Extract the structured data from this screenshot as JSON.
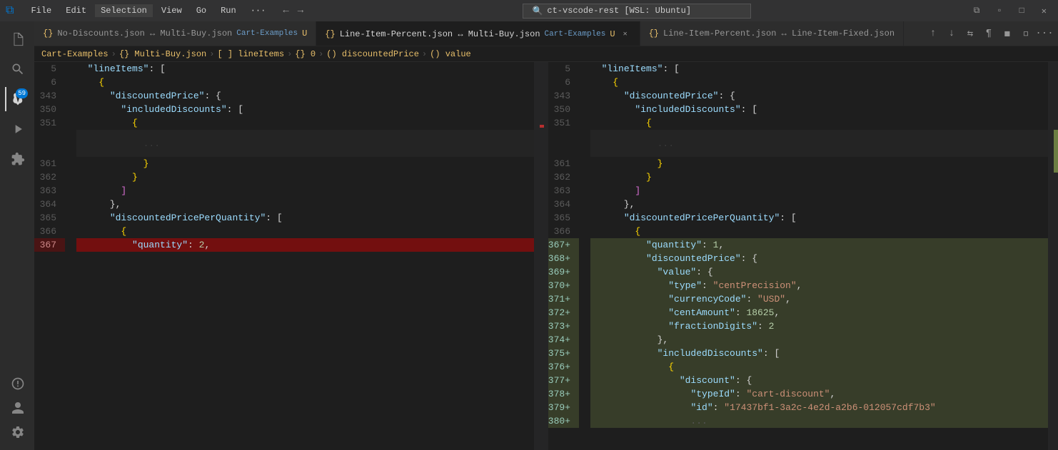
{
  "titlebar": {
    "logo": "⌨",
    "menus": [
      "File",
      "Edit",
      "Selection",
      "View",
      "Go",
      "Run",
      "···"
    ],
    "search_text": "ct-vscode-rest [WSL: Ubuntu]",
    "nav_back": "←",
    "nav_forward": "→",
    "controls": [
      "⧉",
      "🗖",
      "⧠",
      "✕"
    ]
  },
  "activity_bar": {
    "icons": [
      {
        "name": "explorer-icon",
        "glyph": "⎗",
        "active": false
      },
      {
        "name": "search-icon",
        "glyph": "🔍",
        "active": false
      },
      {
        "name": "source-control-icon",
        "glyph": "⑂",
        "active": true,
        "badge": "59"
      },
      {
        "name": "run-icon",
        "glyph": "▷",
        "active": false
      },
      {
        "name": "extensions-icon",
        "glyph": "⊞",
        "active": false
      },
      {
        "name": "remote-icon",
        "glyph": "⊙",
        "active": false
      },
      {
        "name": "accounts-icon",
        "glyph": "👤",
        "active": false,
        "bottom": true
      },
      {
        "name": "settings-icon",
        "glyph": "⚙",
        "active": false,
        "bottom": true
      }
    ]
  },
  "tabs": [
    {
      "id": "tab1",
      "icon": "{}",
      "label": "No-Discounts.json",
      "arrow": "↔",
      "label2": "Multi-Buy.json",
      "path": "Cart-Examples",
      "dirty": true,
      "active": false,
      "closable": false
    },
    {
      "id": "tab2",
      "icon": "{}",
      "label": "Line-Item-Percent.json",
      "arrow": "↔",
      "label2": "Multi-Buy.json",
      "path": "Cart-Examples",
      "dirty": true,
      "active": true,
      "closable": true
    },
    {
      "id": "tab3",
      "icon": "{}",
      "label": "Line-Item-Percent.json",
      "arrow": "↔",
      "label2": "Line-Item-Fixed.json",
      "path": "",
      "dirty": false,
      "active": false,
      "closable": false
    }
  ],
  "breadcrumb": {
    "parts": [
      "Cart-Examples",
      ">",
      "{} Multi-Buy.json",
      ">",
      "[ ] lineItems",
      ">",
      "{} 0",
      ">",
      "() discountedPrice",
      ">",
      "() value"
    ]
  },
  "left_pane": {
    "lines": [
      {
        "num": "5",
        "diff": "",
        "content": [
          {
            "t": "  ",
            "c": ""
          },
          {
            "t": "\"lineItems\"",
            "c": "s-key"
          },
          {
            "t": ": [",
            "c": "s-punct"
          }
        ]
      },
      {
        "num": "6",
        "diff": "",
        "content": [
          {
            "t": "    {",
            "c": "s-brace"
          }
        ]
      },
      {
        "num": "343",
        "diff": "",
        "content": [
          {
            "t": "      ",
            "c": ""
          },
          {
            "t": "\"discountedPrice\"",
            "c": "s-key"
          },
          {
            "t": ": {",
            "c": "s-punct"
          }
        ]
      },
      {
        "num": "350",
        "diff": "",
        "content": [
          {
            "t": "        ",
            "c": ""
          },
          {
            "t": "\"includedDiscounts\"",
            "c": "s-key"
          },
          {
            "t": ": [",
            "c": "s-punct"
          }
        ]
      },
      {
        "num": "351",
        "diff": "",
        "content": [
          {
            "t": "          {",
            "c": "s-brace"
          }
        ]
      },
      {
        "num": "",
        "diff": "blurred",
        "content": [
          {
            "t": "            ...",
            "c": "s-punct"
          }
        ]
      },
      {
        "num": "361",
        "diff": "",
        "content": [
          {
            "t": "            }",
            "c": "s-brace"
          }
        ]
      },
      {
        "num": "362",
        "diff": "",
        "content": [
          {
            "t": "          }",
            "c": "s-brace"
          }
        ]
      },
      {
        "num": "363",
        "diff": "",
        "content": [
          {
            "t": "        ]",
            "c": "s-bracket"
          }
        ]
      },
      {
        "num": "364",
        "diff": "",
        "content": [
          {
            "t": "      },",
            "c": "s-punct"
          }
        ]
      },
      {
        "num": "365",
        "diff": "",
        "content": [
          {
            "t": "      ",
            "c": ""
          },
          {
            "t": "\"discountedPricePerQuantity\"",
            "c": "s-key"
          },
          {
            "t": ": [",
            "c": "s-punct"
          }
        ]
      },
      {
        "num": "366",
        "diff": "",
        "content": [
          {
            "t": "        {",
            "c": "s-brace"
          }
        ]
      },
      {
        "num": "367",
        "diff": "deleted",
        "content": [
          {
            "t": "          ",
            "c": ""
          },
          {
            "t": "\"quantity\"",
            "c": "s-key"
          },
          {
            "t": ": ",
            "c": "s-punct"
          },
          {
            "t": "2",
            "c": "s-num"
          },
          {
            "t": ",",
            "c": "s-punct"
          }
        ]
      }
    ]
  },
  "right_pane": {
    "lines": [
      {
        "num": "5",
        "diff": "",
        "content": [
          {
            "t": "  ",
            "c": ""
          },
          {
            "t": "\"lineItems\"",
            "c": "s-key"
          },
          {
            "t": ": [",
            "c": "s-punct"
          }
        ]
      },
      {
        "num": "6",
        "diff": "",
        "content": [
          {
            "t": "    {",
            "c": "s-brace"
          }
        ]
      },
      {
        "num": "343",
        "diff": "",
        "content": [
          {
            "t": "      ",
            "c": ""
          },
          {
            "t": "\"discountedPrice\"",
            "c": "s-key"
          },
          {
            "t": ": {",
            "c": "s-punct"
          }
        ]
      },
      {
        "num": "350",
        "diff": "",
        "content": [
          {
            "t": "        ",
            "c": ""
          },
          {
            "t": "\"includedDiscounts\"",
            "c": "s-key"
          },
          {
            "t": ": [",
            "c": "s-punct"
          }
        ]
      },
      {
        "num": "351",
        "diff": "",
        "content": [
          {
            "t": "          {",
            "c": "s-brace"
          }
        ]
      },
      {
        "num": "",
        "diff": "blurred",
        "content": [
          {
            "t": "            ...",
            "c": "s-punct"
          }
        ]
      },
      {
        "num": "361",
        "diff": "",
        "content": [
          {
            "t": "            }",
            "c": "s-brace"
          }
        ]
      },
      {
        "num": "362",
        "diff": "",
        "content": [
          {
            "t": "          }",
            "c": "s-brace"
          }
        ]
      },
      {
        "num": "363",
        "diff": "",
        "content": [
          {
            "t": "        ]",
            "c": "s-bracket"
          }
        ]
      },
      {
        "num": "364",
        "diff": "",
        "content": [
          {
            "t": "      },",
            "c": "s-punct"
          }
        ]
      },
      {
        "num": "365",
        "diff": "",
        "content": [
          {
            "t": "      ",
            "c": ""
          },
          {
            "t": "\"discountedPricePerQuantity\"",
            "c": "s-key"
          },
          {
            "t": ": [",
            "c": "s-punct"
          }
        ]
      },
      {
        "num": "366",
        "diff": "",
        "content": [
          {
            "t": "        {",
            "c": "s-brace"
          }
        ]
      },
      {
        "num": "367+",
        "diff": "added",
        "content": [
          {
            "t": "          ",
            "c": ""
          },
          {
            "t": "\"quantity\"",
            "c": "s-key"
          },
          {
            "t": ": ",
            "c": "s-punct"
          },
          {
            "t": "1",
            "c": "s-num"
          },
          {
            "t": ",",
            "c": "s-punct"
          }
        ]
      },
      {
        "num": "368+",
        "diff": "added",
        "content": [
          {
            "t": "          ",
            "c": ""
          },
          {
            "t": "\"discountedPrice\"",
            "c": "s-key"
          },
          {
            "t": ": {",
            "c": "s-punct"
          }
        ]
      },
      {
        "num": "369+",
        "diff": "added",
        "content": [
          {
            "t": "            ",
            "c": ""
          },
          {
            "t": "\"value\"",
            "c": "s-key"
          },
          {
            "t": ": {",
            "c": "s-punct"
          }
        ]
      },
      {
        "num": "370+",
        "diff": "added",
        "content": [
          {
            "t": "              ",
            "c": ""
          },
          {
            "t": "\"type\"",
            "c": "s-key"
          },
          {
            "t": ": ",
            "c": "s-punct"
          },
          {
            "t": "\"centPrecision\"",
            "c": "s-str"
          },
          {
            "t": ",",
            "c": "s-punct"
          }
        ]
      },
      {
        "num": "371+",
        "diff": "added",
        "content": [
          {
            "t": "              ",
            "c": ""
          },
          {
            "t": "\"currencyCode\"",
            "c": "s-key"
          },
          {
            "t": ": ",
            "c": "s-punct"
          },
          {
            "t": "\"USD\"",
            "c": "s-str"
          },
          {
            "t": ",",
            "c": "s-punct"
          }
        ]
      },
      {
        "num": "372+",
        "diff": "added",
        "content": [
          {
            "t": "              ",
            "c": ""
          },
          {
            "t": "\"centAmount\"",
            "c": "s-key"
          },
          {
            "t": ": ",
            "c": "s-punct"
          },
          {
            "t": "18625",
            "c": "s-num"
          },
          {
            "t": ",",
            "c": "s-punct"
          }
        ]
      },
      {
        "num": "373+",
        "diff": "added",
        "content": [
          {
            "t": "              ",
            "c": ""
          },
          {
            "t": "\"fractionDigits\"",
            "c": "s-key"
          },
          {
            "t": ": ",
            "c": "s-punct"
          },
          {
            "t": "2",
            "c": "s-num"
          }
        ]
      },
      {
        "num": "374+",
        "diff": "added",
        "content": [
          {
            "t": "            },",
            "c": "s-punct"
          }
        ]
      },
      {
        "num": "375+",
        "diff": "added",
        "content": [
          {
            "t": "            ",
            "c": ""
          },
          {
            "t": "\"includedDiscounts\"",
            "c": "s-key"
          },
          {
            "t": ": [",
            "c": "s-punct"
          }
        ]
      },
      {
        "num": "376+",
        "diff": "added",
        "content": [
          {
            "t": "              {",
            "c": "s-brace"
          }
        ]
      },
      {
        "num": "377+",
        "diff": "added",
        "content": [
          {
            "t": "                ",
            "c": ""
          },
          {
            "t": "\"discount\"",
            "c": "s-key"
          },
          {
            "t": ": {",
            "c": "s-punct"
          }
        ]
      },
      {
        "num": "378+",
        "diff": "added",
        "content": [
          {
            "t": "                  ",
            "c": ""
          },
          {
            "t": "\"typeId\"",
            "c": "s-key"
          },
          {
            "t": ": ",
            "c": "s-punct"
          },
          {
            "t": "\"cart-discount\"",
            "c": "s-str"
          },
          {
            "t": ",",
            "c": "s-punct"
          }
        ]
      },
      {
        "num": "379+",
        "diff": "added",
        "content": [
          {
            "t": "                  ",
            "c": ""
          },
          {
            "t": "\"id\"",
            "c": "s-key"
          },
          {
            "t": ": ",
            "c": "s-punct"
          },
          {
            "t": "\"17437bf1-3a2c-4e2d-a2b6-012057cdf7b3\"",
            "c": "s-str"
          }
        ]
      },
      {
        "num": "380+",
        "diff": "added",
        "content": [
          {
            "t": "                ...",
            "c": "s-punct"
          }
        ]
      }
    ]
  }
}
